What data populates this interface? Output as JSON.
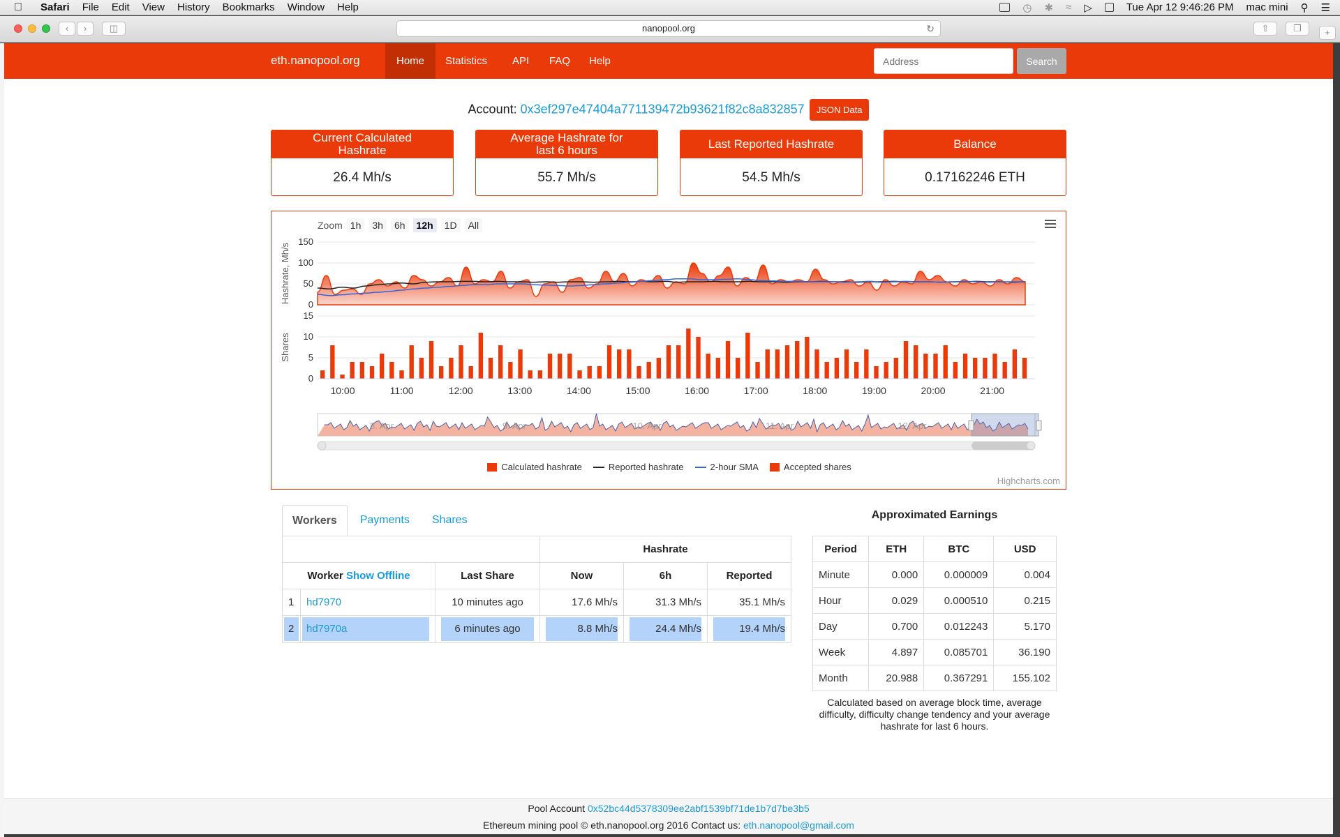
{
  "menubar": {
    "apple": "",
    "app": "Safari",
    "items": [
      "File",
      "Edit",
      "View",
      "History",
      "Bookmarks",
      "Window",
      "Help"
    ],
    "clock": "Tue Apr 12  9:46:26 PM",
    "user": "mac mini"
  },
  "browser": {
    "url": "nanopool.org",
    "back_icon": "chevron-left-icon",
    "forward_icon": "chevron-right-icon"
  },
  "site": {
    "brand": "eth.nanopool.org",
    "nav": [
      "Home",
      "Statistics",
      "API",
      "FAQ",
      "Help"
    ],
    "search_placeholder": "Address",
    "search_label": "Search"
  },
  "account": {
    "label": "Account:",
    "address": "0x3ef297e47404a771139472b93621f82c8a832857",
    "json_label": "JSON Data"
  },
  "stats": [
    {
      "title": "Current Calculated Hashrate",
      "value": "26.4 Mh/s"
    },
    {
      "title": "Average Hashrate for last 6 hours",
      "value": "55.7 Mh/s"
    },
    {
      "title": "Last Reported Hashrate",
      "value": "54.5 Mh/s"
    },
    {
      "title": "Balance",
      "value": "0.17162246 ETH"
    }
  ],
  "chart": {
    "zoom_label": "Zoom",
    "zoom_options": [
      "1h",
      "3h",
      "6h",
      "12h",
      "1D",
      "All"
    ],
    "zoom_active": "12h",
    "credit": "Highcharts.com",
    "colors": {
      "accent": "#eb3a0a",
      "reported": "#222222",
      "sma": "#3366dd"
    }
  },
  "chart_data": {
    "type": "line",
    "x_ticks": [
      "10:00",
      "11:00",
      "12:00",
      "13:00",
      "14:00",
      "15:00",
      "16:00",
      "17:00",
      "18:00",
      "19:00",
      "20:00",
      "21:00"
    ],
    "navigator_labels": [
      "8. Apr",
      "9. Apr",
      "10. Apr",
      "11. Apr",
      "12. Apr"
    ],
    "hashrate_axis": {
      "label": "Hashrate, Mh/s",
      "ticks": [
        0,
        50,
        100,
        150
      ],
      "ylim": [
        0,
        150
      ]
    },
    "shares_axis": {
      "label": "Shares",
      "ticks": [
        0,
        5,
        10,
        15
      ],
      "ylim": [
        0,
        15
      ]
    },
    "series": [
      {
        "name": "Calculated hashrate",
        "values": [
          30,
          70,
          25,
          35,
          38,
          25,
          50,
          60,
          45,
          55,
          40,
          70,
          60,
          45,
          55,
          65,
          45,
          90,
          50,
          60,
          55,
          80,
          40,
          55,
          60,
          20,
          50,
          55,
          30,
          60,
          65,
          40,
          50,
          80,
          55,
          75,
          45,
          60,
          55,
          70,
          40,
          55,
          50,
          100,
          75,
          55,
          70,
          90,
          45,
          65,
          55,
          95,
          50,
          60,
          55,
          60,
          55,
          85,
          60,
          50,
          55,
          60,
          45,
          55,
          35,
          60,
          45,
          55,
          50,
          80,
          60,
          70,
          55,
          45,
          60,
          50,
          55,
          45,
          60,
          50,
          65,
          55
        ]
      },
      {
        "name": "Reported hashrate",
        "values": [
          40,
          38,
          42,
          40,
          45,
          48,
          50,
          52,
          50,
          54,
          55,
          55,
          56,
          56,
          55,
          56,
          55,
          55,
          54,
          55,
          54,
          55,
          55,
          54,
          55,
          56,
          55,
          56,
          55,
          56,
          54,
          55,
          55,
          56,
          55,
          55,
          56,
          55,
          55,
          54,
          55,
          55,
          56,
          55,
          55,
          54,
          55,
          55,
          56,
          55,
          55,
          55,
          54,
          55,
          55,
          56,
          55,
          55,
          54,
          55
        ]
      },
      {
        "name": "2-hour SMA",
        "values": [
          25,
          22,
          24,
          26,
          28,
          30,
          32,
          35,
          38,
          40,
          42,
          44,
          46,
          48,
          48,
          50,
          50,
          50,
          48,
          47,
          46,
          45,
          46,
          48,
          50,
          52,
          54,
          56,
          58,
          60,
          62,
          62,
          60,
          60,
          61,
          62,
          60,
          58,
          57,
          56,
          56,
          55,
          55,
          55,
          54,
          55,
          56,
          54,
          55,
          56,
          55,
          55,
          54,
          55,
          56,
          55,
          54,
          55,
          55,
          55
        ]
      },
      {
        "name": "Accepted shares",
        "values": [
          2,
          8,
          1,
          4,
          4,
          3,
          6,
          4,
          2,
          8,
          5,
          9,
          3,
          5,
          8,
          3,
          11,
          5,
          8,
          4,
          7,
          2,
          2,
          6,
          6,
          6,
          2,
          3,
          3,
          8,
          7,
          7,
          3,
          4,
          5,
          8,
          8,
          12,
          10,
          6,
          5,
          9,
          5,
          11,
          4,
          7,
          7,
          8,
          9,
          10,
          7,
          4,
          5,
          7,
          4,
          7,
          3,
          4,
          5,
          9,
          8,
          6,
          6,
          8,
          4,
          6,
          5,
          5,
          6,
          4,
          7,
          5
        ]
      }
    ]
  },
  "tabs": [
    "Workers",
    "Payments",
    "Shares"
  ],
  "workers": {
    "group_header": "Hashrate",
    "headers": {
      "worker": "Worker",
      "show_offline": "Show Offline",
      "last_share": "Last Share",
      "now": "Now",
      "h6": "6h",
      "reported": "Reported"
    },
    "rows": [
      {
        "index": "1",
        "name": "hd7970",
        "last_share": "10 minutes ago",
        "now": "17.6 Mh/s",
        "h6": "31.3 Mh/s",
        "reported": "35.1 Mh/s"
      },
      {
        "index": "2",
        "name": "hd7970a",
        "last_share": "6 minutes ago",
        "now": "8.8 Mh/s",
        "h6": "24.4 Mh/s",
        "reported": "19.4 Mh/s"
      }
    ]
  },
  "earnings": {
    "title": "Approximated Earnings",
    "headers": [
      "Period",
      "ETH",
      "BTC",
      "USD"
    ],
    "rows": [
      [
        "Minute",
        "0.000",
        "0.000009",
        "0.004"
      ],
      [
        "Hour",
        "0.029",
        "0.000510",
        "0.215"
      ],
      [
        "Day",
        "0.700",
        "0.012243",
        "5.170"
      ],
      [
        "Week",
        "4.897",
        "0.085701",
        "36.190"
      ],
      [
        "Month",
        "20.988",
        "0.367291",
        "155.102"
      ]
    ],
    "note": "Calculated based on average block time, average difficulty, difficulty change tendency and your average hashrate for last 6 hours."
  },
  "footer": {
    "pool_label": "Pool Account",
    "pool_address": "0x52bc44d5378309ee2abf1539bf71de1b7d7be3b5",
    "copyright": "Ethereum mining pool © eth.nanopool.org 2016 Contact us:",
    "email": "eth.nanopool@gmail.com"
  }
}
